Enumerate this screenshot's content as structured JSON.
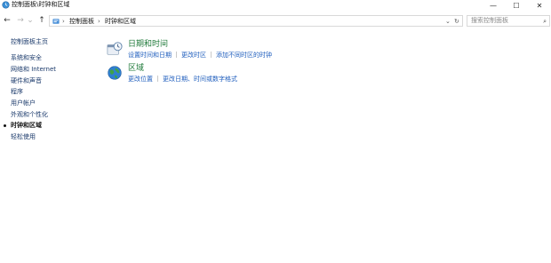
{
  "window": {
    "title": "控制面板\\时钟和区域",
    "minimize": "—",
    "maximize": "☐",
    "close": "✕"
  },
  "nav": {
    "back": "←",
    "forward": "→",
    "recent": "⌄",
    "up": "↑"
  },
  "address": {
    "breadcrumbs": [
      "控制面板",
      "时钟和区域"
    ],
    "separator": "›",
    "dropdown": "⌄",
    "refresh": "↻"
  },
  "search": {
    "placeholder": "搜索控制面板",
    "icon": "⌕"
  },
  "sidebar": {
    "home": "控制面板主页",
    "items": [
      {
        "label": "系统和安全"
      },
      {
        "label": "网络和 Internet"
      },
      {
        "label": "硬件和声音"
      },
      {
        "label": "程序"
      },
      {
        "label": "用户帐户"
      },
      {
        "label": "外观和个性化"
      },
      {
        "label": "时钟和区域",
        "current": true
      },
      {
        "label": "轻松使用"
      }
    ]
  },
  "categories": [
    {
      "title": "日期和时间",
      "icon": "clock-icon",
      "links": [
        "设置时间和日期",
        "更改时区",
        "添加不同时区的时钟"
      ]
    },
    {
      "title": "区域",
      "icon": "globe-icon",
      "links": [
        "更改位置",
        "更改日期、时间或数字格式"
      ]
    }
  ],
  "colors": {
    "category_title": "#1f7a3a",
    "link": "#1e5dbd",
    "sidebar_link": "#1b3a6b"
  }
}
